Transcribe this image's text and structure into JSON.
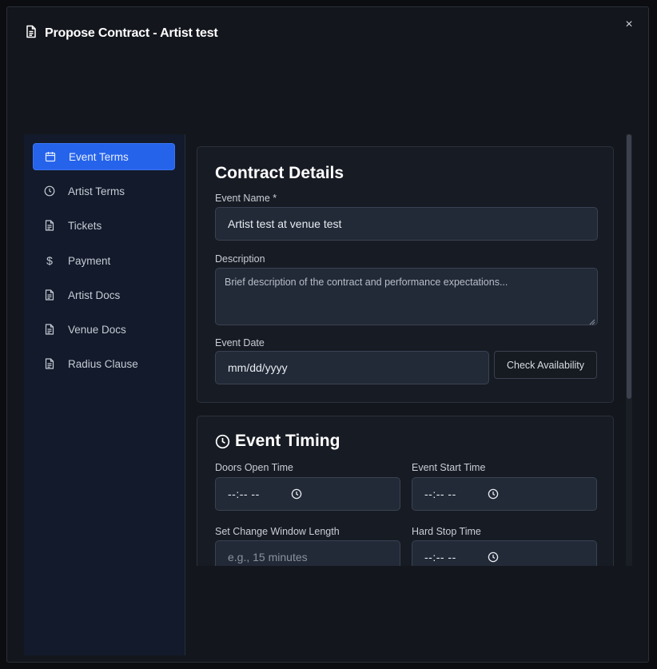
{
  "modal": {
    "title": "Propose Contract - Artist test",
    "close_label": "×"
  },
  "sidebar": {
    "items": [
      {
        "label": "Event Terms",
        "icon": "calendar-icon",
        "active": true
      },
      {
        "label": "Artist Terms",
        "icon": "clock-icon"
      },
      {
        "label": "Tickets",
        "icon": "document-icon"
      },
      {
        "label": "Payment",
        "icon": "dollar-icon"
      },
      {
        "label": "Artist Docs",
        "icon": "document-icon"
      },
      {
        "label": "Venue Docs",
        "icon": "document-icon"
      },
      {
        "label": "Radius Clause",
        "icon": "document-icon"
      }
    ]
  },
  "contract_details": {
    "title": "Contract Details",
    "event_name_label": "Event Name *",
    "event_name_value": "Artist test at venue test",
    "description_label": "Description",
    "description_placeholder": "Brief description of the contract and performance expectations...",
    "event_date_label": "Event Date",
    "event_date_placeholder": "mm/dd/yyyy",
    "check_availability_label": "Check Availability"
  },
  "event_timing": {
    "title": "Event Timing",
    "doors_open_label": "Doors Open Time",
    "doors_open_value": "--:-- --",
    "event_start_label": "Event Start Time",
    "event_start_value": "--:-- --",
    "set_change_label": "Set Change Window Length",
    "set_change_placeholder": "e.g., 15 minutes",
    "hard_stop_label": "Hard Stop Time",
    "hard_stop_value": "--:-- --"
  },
  "colors": {
    "accent": "#2563eb",
    "background": "#13161c",
    "sidebar": "#121a2b",
    "input": "#222a38"
  }
}
